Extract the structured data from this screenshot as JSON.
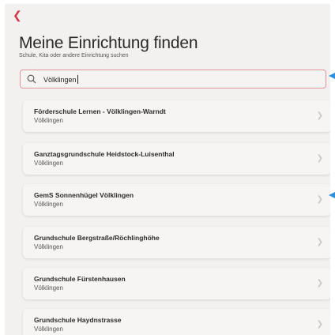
{
  "header": {
    "back_icon": "chevron-left-icon",
    "title": "Meine Einrichtung finden",
    "subtitle": "Schule, Kita oder andere Einrichtung suchen"
  },
  "search": {
    "icon": "search-icon",
    "value": "Völklingen"
  },
  "colors": {
    "accent": "#d23a4a",
    "marker": "#2f8fd9"
  },
  "results": [
    {
      "name": "Förderschule Lernen - Völklingen-Warndt",
      "city": "Völklingen"
    },
    {
      "name": "Ganztagsgrundschule Heidstock-Luisenthal",
      "city": "Völklingen"
    },
    {
      "name": "GemS Sonnenhügel Völklingen",
      "city": "Völklingen"
    },
    {
      "name": "Grundschule Bergstraße/Röchlinghöhe",
      "city": "Völklingen"
    },
    {
      "name": "Grundschule Fürstenhausen",
      "city": "Völklingen"
    },
    {
      "name": "Grundschule Haydnstrasse",
      "city": "Völklingen"
    }
  ]
}
